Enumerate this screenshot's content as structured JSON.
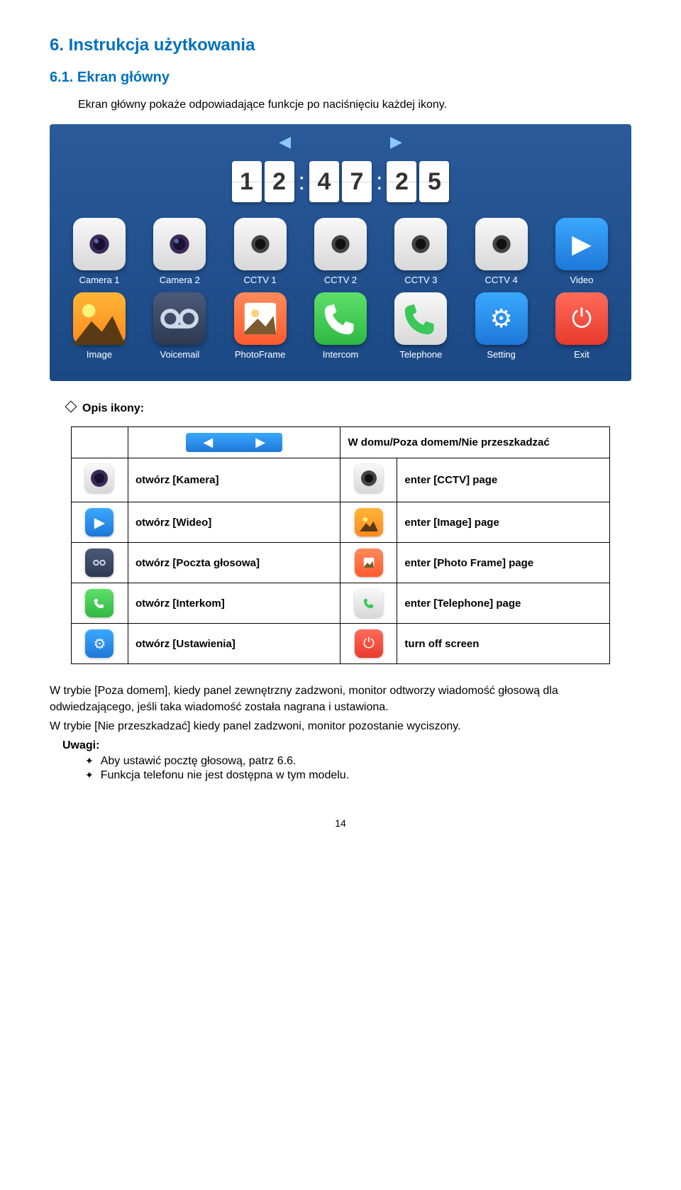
{
  "h1": "6. Instrukcja użytkowania",
  "h2": "6.1. Ekran główny",
  "intro": "Ekran główny pokaże odpowiadające funkcje po naciśnięciu każdej ikony.",
  "clock": {
    "d1": "1",
    "d2": "2",
    "d3": "4",
    "d4": "7",
    "d5": "2",
    "d6": "5",
    "colon": ":"
  },
  "apps_row1": [
    {
      "label": "Camera 1"
    },
    {
      "label": "Camera 2"
    },
    {
      "label": "CCTV 1"
    },
    {
      "label": "CCTV 2"
    },
    {
      "label": "CCTV 3"
    },
    {
      "label": "CCTV 4"
    },
    {
      "label": "Video"
    }
  ],
  "apps_row2": [
    {
      "label": "Image"
    },
    {
      "label": "Voicemail"
    },
    {
      "label": "PhotoFrame"
    },
    {
      "label": "Intercom"
    },
    {
      "label": "Telephone"
    },
    {
      "label": "Setting"
    },
    {
      "label": "Exit"
    }
  ],
  "opis_heading": "Opis ikony:",
  "table": {
    "header_span": "W domu/Poza domem/Nie przeszkadzać",
    "rows": [
      {
        "left": "otwórz [Kamera]",
        "right": "enter [CCTV] page"
      },
      {
        "left": "otwórz [Wideo]",
        "right": "enter [Image] page"
      },
      {
        "left": "otwórz [Poczta głosowa]",
        "right": "enter [Photo Frame] page"
      },
      {
        "left": "otwórz [Interkom]",
        "right": "enter [Telephone] page"
      },
      {
        "left": "otwórz [Ustawienia]",
        "right": "turn off screen"
      }
    ]
  },
  "paras": [
    "W trybie [Poza domem], kiedy panel zewnętrzny zadzwoni, monitor odtworzy wiadomość głosową dla odwiedzającego, jeśli taka wiadomość została nagrana i ustawiona.",
    "W trybie [Nie przeszkadzać] kiedy panel zadzwoni, monitor pozostanie wyciszony."
  ],
  "uwagi_label": "Uwagi:",
  "bullets": [
    "Aby ustawić pocztę głosową, patrz 6.6.",
    "Funkcja telefonu nie jest dostępna w tym modelu."
  ],
  "page_number": "14"
}
